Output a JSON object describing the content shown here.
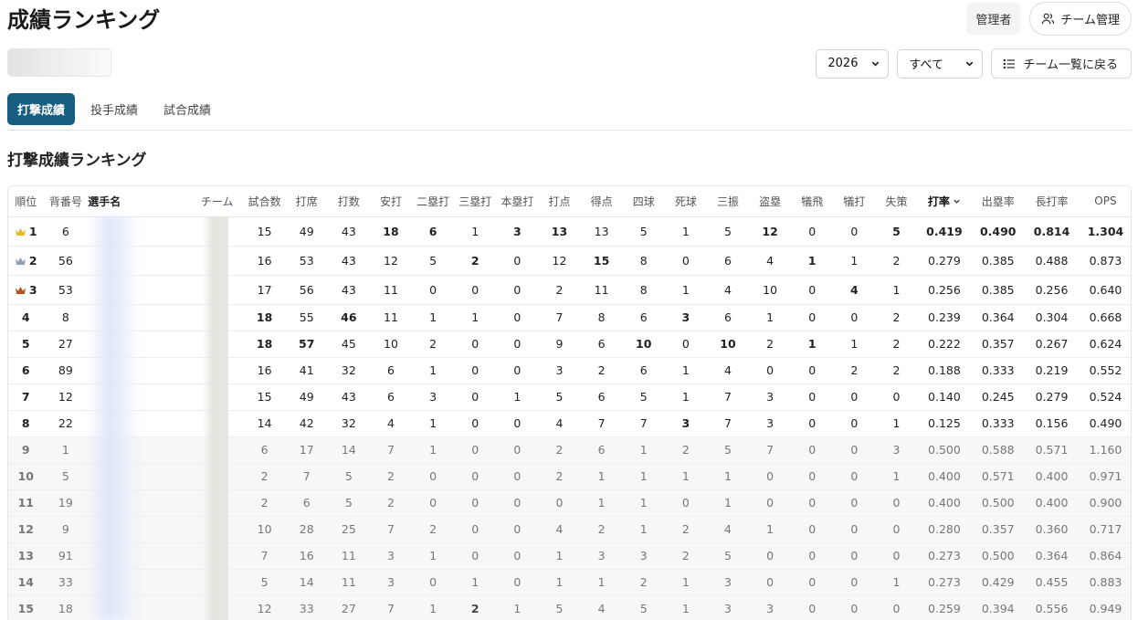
{
  "header": {
    "title": "成績ランキング",
    "admin_label": "管理者",
    "team_manage_label": "チーム管理"
  },
  "controls": {
    "year": "2026",
    "filter": "すべて",
    "back_label": "チーム一覧に戻る"
  },
  "tabs": [
    "打撃成績",
    "投手成績",
    "試合成績"
  ],
  "section_title": "打撃成績ランキング",
  "table": {
    "headers": [
      "順位",
      "背番号",
      "選手名",
      "チーム",
      "試合数",
      "打席",
      "打数",
      "安打",
      "二塁打",
      "三塁打",
      "本塁打",
      "打点",
      "得点",
      "四球",
      "死球",
      "三振",
      "盗塁",
      "犠飛",
      "犠打",
      "失策",
      "打率",
      "出塁率",
      "長打率",
      "OPS"
    ],
    "rows": [
      [
        "1",
        "6",
        "",
        "",
        "15",
        "49",
        "43",
        "18",
        "6",
        "1",
        "3",
        "13",
        "13",
        "5",
        "1",
        "5",
        "12",
        "0",
        "0",
        "5",
        "0.419",
        "0.490",
        "0.814",
        "1.304"
      ],
      [
        "2",
        "56",
        "",
        "",
        "16",
        "53",
        "43",
        "12",
        "5",
        "2",
        "0",
        "12",
        "15",
        "8",
        "0",
        "6",
        "4",
        "1",
        "1",
        "2",
        "0.279",
        "0.385",
        "0.488",
        "0.873"
      ],
      [
        "3",
        "53",
        "",
        "",
        "17",
        "56",
        "43",
        "11",
        "0",
        "0",
        "0",
        "2",
        "11",
        "8",
        "1",
        "4",
        "10",
        "0",
        "4",
        "1",
        "0.256",
        "0.385",
        "0.256",
        "0.640"
      ],
      [
        "4",
        "8",
        "",
        "",
        "18",
        "55",
        "46",
        "11",
        "1",
        "1",
        "0",
        "7",
        "8",
        "6",
        "3",
        "6",
        "1",
        "0",
        "0",
        "2",
        "0.239",
        "0.364",
        "0.304",
        "0.668"
      ],
      [
        "5",
        "27",
        "",
        "",
        "18",
        "57",
        "45",
        "10",
        "2",
        "0",
        "0",
        "9",
        "6",
        "10",
        "0",
        "10",
        "2",
        "1",
        "1",
        "2",
        "0.222",
        "0.357",
        "0.267",
        "0.624"
      ],
      [
        "6",
        "89",
        "",
        "",
        "16",
        "41",
        "32",
        "6",
        "1",
        "0",
        "0",
        "3",
        "2",
        "6",
        "1",
        "4",
        "0",
        "0",
        "2",
        "2",
        "0.188",
        "0.333",
        "0.219",
        "0.552"
      ],
      [
        "7",
        "12",
        "",
        "",
        "15",
        "49",
        "43",
        "6",
        "3",
        "0",
        "1",
        "5",
        "6",
        "5",
        "1",
        "7",
        "3",
        "0",
        "0",
        "0",
        "0.140",
        "0.245",
        "0.279",
        "0.524"
      ],
      [
        "8",
        "22",
        "",
        "",
        "14",
        "42",
        "32",
        "4",
        "1",
        "0",
        "0",
        "4",
        "7",
        "7",
        "3",
        "7",
        "3",
        "0",
        "0",
        "1",
        "0.125",
        "0.333",
        "0.156",
        "0.490"
      ],
      [
        "9",
        "1",
        "",
        "",
        "6",
        "17",
        "14",
        "7",
        "1",
        "0",
        "0",
        "2",
        "6",
        "1",
        "2",
        "5",
        "7",
        "0",
        "0",
        "3",
        "0.500",
        "0.588",
        "0.571",
        "1.160"
      ],
      [
        "10",
        "5",
        "",
        "",
        "2",
        "7",
        "5",
        "2",
        "0",
        "0",
        "0",
        "2",
        "1",
        "1",
        "1",
        "1",
        "0",
        "0",
        "0",
        "1",
        "0.400",
        "0.571",
        "0.400",
        "0.971"
      ],
      [
        "11",
        "19",
        "",
        "",
        "2",
        "6",
        "5",
        "2",
        "0",
        "0",
        "0",
        "0",
        "1",
        "1",
        "0",
        "1",
        "0",
        "0",
        "0",
        "0",
        "0.400",
        "0.500",
        "0.400",
        "0.900"
      ],
      [
        "12",
        "9",
        "",
        "",
        "10",
        "28",
        "25",
        "7",
        "2",
        "0",
        "0",
        "4",
        "2",
        "1",
        "2",
        "4",
        "1",
        "0",
        "0",
        "0",
        "0.280",
        "0.357",
        "0.360",
        "0.717"
      ],
      [
        "13",
        "91",
        "",
        "",
        "7",
        "16",
        "11",
        "3",
        "1",
        "0",
        "0",
        "1",
        "3",
        "3",
        "2",
        "5",
        "0",
        "0",
        "0",
        "0",
        "0.273",
        "0.500",
        "0.364",
        "0.864"
      ],
      [
        "14",
        "33",
        "",
        "",
        "5",
        "14",
        "11",
        "3",
        "0",
        "1",
        "0",
        "1",
        "1",
        "2",
        "1",
        "3",
        "0",
        "0",
        "0",
        "1",
        "0.273",
        "0.429",
        "0.455",
        "0.883"
      ],
      [
        "15",
        "18",
        "",
        "",
        "12",
        "33",
        "27",
        "7",
        "1",
        "2",
        "1",
        "5",
        "4",
        "5",
        "1",
        "3",
        "3",
        "0",
        "0",
        "0",
        "0.259",
        "0.394",
        "0.556",
        "0.949"
      ]
    ],
    "bold_cells": [
      [
        0,
        7
      ],
      [
        0,
        8
      ],
      [
        0,
        10
      ],
      [
        0,
        11
      ],
      [
        0,
        16
      ],
      [
        0,
        19
      ],
      [
        0,
        20
      ],
      [
        0,
        21
      ],
      [
        0,
        22
      ],
      [
        0,
        23
      ],
      [
        1,
        9
      ],
      [
        1,
        12
      ],
      [
        1,
        17
      ],
      [
        2,
        18
      ],
      [
        3,
        4
      ],
      [
        3,
        6
      ],
      [
        3,
        14
      ],
      [
        4,
        4
      ],
      [
        4,
        5
      ],
      [
        4,
        13
      ],
      [
        4,
        15
      ],
      [
        4,
        17
      ],
      [
        7,
        14
      ],
      [
        14,
        9
      ]
    ],
    "crown_colors": [
      "#e9b92a",
      "#8f9fb8",
      "#b5531b"
    ],
    "eligible_rows": 8
  }
}
